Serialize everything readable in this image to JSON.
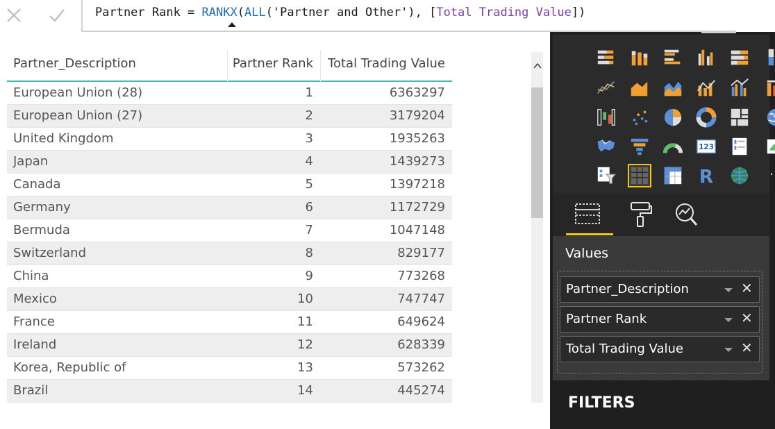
{
  "formula_bar": {
    "cancel_icon": "close-icon",
    "commit_icon": "check-icon",
    "measure_name": "Partner Rank = ",
    "fn_rankx": "RANKX",
    "open_paren": "(",
    "fn_all": "ALL",
    "table_arg": "('Partner and Other'), ",
    "open_bracket": "[",
    "measure_ref": "Total Trading Value",
    "close": "])"
  },
  "table": {
    "columns": {
      "description": "Partner_Description",
      "rank": "Partner Rank",
      "total": "Total Trading Value"
    },
    "sorted_column": "rank",
    "sort_direction": "ascending",
    "rows": [
      {
        "description": "European Union (28)",
        "rank": "1",
        "total": "6363297"
      },
      {
        "description": "European Union (27)",
        "rank": "2",
        "total": "3179204"
      },
      {
        "description": "United Kingdom",
        "rank": "3",
        "total": "1935263"
      },
      {
        "description": "Japan",
        "rank": "4",
        "total": "1439273"
      },
      {
        "description": "Canada",
        "rank": "5",
        "total": "1397218"
      },
      {
        "description": "Germany",
        "rank": "6",
        "total": "1172729"
      },
      {
        "description": "Bermuda",
        "rank": "7",
        "total": "1047148"
      },
      {
        "description": "Switzerland",
        "rank": "8",
        "total": "829177"
      },
      {
        "description": "China",
        "rank": "9",
        "total": "773268"
      },
      {
        "description": "Mexico",
        "rank": "10",
        "total": "747747"
      },
      {
        "description": "France",
        "rank": "11",
        "total": "649624"
      },
      {
        "description": "Ireland",
        "rank": "12",
        "total": "628339"
      },
      {
        "description": "Korea, Republic of",
        "rank": "13",
        "total": "573262"
      },
      {
        "description": "Brazil",
        "rank": "14",
        "total": "445274"
      }
    ]
  },
  "scrollbar": {
    "up_arrow": "^"
  },
  "visualizations": {
    "icons": [
      "stacked-bar-chart-icon",
      "stacked-column-chart-icon",
      "clustered-bar-chart-icon",
      "clustered-column-chart-icon",
      "100-stacked-bar-chart-icon",
      "100-stacked-column-chart-icon",
      "line-chart-icon",
      "area-chart-icon",
      "stacked-area-chart-icon",
      "line-and-stacked-column-icon",
      "line-and-clustered-column-icon",
      "ribbon-chart-icon",
      "waterfall-chart-icon",
      "scatter-chart-icon",
      "pie-chart-icon",
      "donut-chart-icon",
      "treemap-icon",
      "map-icon",
      "filled-map-icon",
      "funnel-icon",
      "gauge-icon",
      "card-icon",
      "multi-row-card-icon",
      "kpi-icon",
      "slicer-icon",
      "table-icon",
      "matrix-icon",
      "r-script-visual-icon",
      "globe-map-icon",
      "more-visuals-icon"
    ],
    "selected": "table-icon",
    "card_text": "123",
    "r_text": "R",
    "more_text": "···"
  },
  "pane_tabs": [
    "fields-tab",
    "format-tab",
    "analytics-tab"
  ],
  "values": {
    "label": "Values",
    "wells": [
      "Partner_Description",
      "Partner Rank",
      "Total Trading Value"
    ],
    "remove_glyph": "✕"
  },
  "filters": {
    "label": "FILTERS"
  },
  "colors": {
    "accent_teal": "#3fb8ae",
    "selection_yellow": "#f2c811",
    "panel_dark": "#1f1f1f",
    "dax_function_blue": "#1f6fb5",
    "dax_measure_purple": "#7b3fa6"
  }
}
